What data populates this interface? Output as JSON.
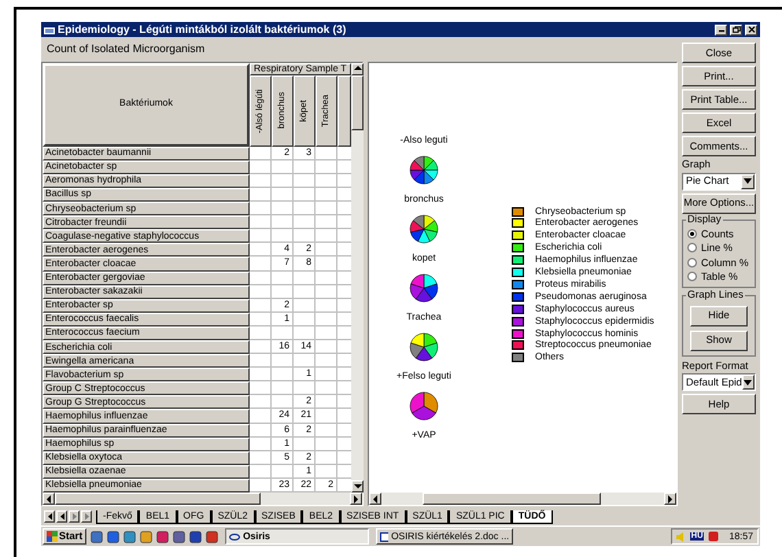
{
  "window": {
    "title": "Epidemiology - Légúti mintákból izolált baktériumok (3)"
  },
  "caption": "Count of Isolated Microorganism",
  "table": {
    "group_header": "Respiratory Sample T",
    "row_header": "Baktériumok",
    "columns": [
      "-Alsó légúti",
      "bronchus",
      "köpet",
      "Trachea"
    ],
    "rows": [
      {
        "name": "Acinetobacter baumannii",
        "cells": {
          "bronchus": "2",
          "kopet": "3"
        }
      },
      {
        "name": "Acinetobacter sp",
        "cells": {}
      },
      {
        "name": "Aeromonas hydrophila",
        "cells": {}
      },
      {
        "name": "Bacillus sp",
        "cells": {}
      },
      {
        "name": "Chryseobacterium sp",
        "cells": {}
      },
      {
        "name": "Citrobacter freundii",
        "cells": {}
      },
      {
        "name": "Coagulase-negative staphylococcus",
        "cells": {}
      },
      {
        "name": "Enterobacter aerogenes",
        "cells": {
          "bronchus": "4",
          "kopet": "2"
        }
      },
      {
        "name": "Enterobacter cloacae",
        "cells": {
          "bronchus": "7",
          "kopet": "8"
        }
      },
      {
        "name": "Enterobacter gergoviae",
        "cells": {}
      },
      {
        "name": "Enterobacter sakazakii",
        "cells": {}
      },
      {
        "name": "Enterobacter sp",
        "cells": {
          "bronchus": "2"
        }
      },
      {
        "name": "Enterococcus faecalis",
        "cells": {
          "bronchus": "1"
        }
      },
      {
        "name": "Enterococcus faecium",
        "cells": {}
      },
      {
        "name": "Escherichia coli",
        "cells": {
          "bronchus": "16",
          "kopet": "14"
        }
      },
      {
        "name": "Ewingella americana",
        "cells": {}
      },
      {
        "name": "Flavobacterium sp",
        "cells": {
          "kopet": "1"
        }
      },
      {
        "name": "Group C Streptococcus",
        "cells": {}
      },
      {
        "name": "Group G Streptococcus",
        "cells": {
          "kopet": "2"
        }
      },
      {
        "name": "Haemophilus influenzae",
        "cells": {
          "bronchus": "24",
          "kopet": "21"
        }
      },
      {
        "name": "Haemophilus parainfluenzae",
        "cells": {
          "bronchus": "6",
          "kopet": "2"
        }
      },
      {
        "name": "Haemophilus sp",
        "cells": {
          "bronchus": "1"
        }
      },
      {
        "name": "Klebsiella oxytoca",
        "cells": {
          "bronchus": "5",
          "kopet": "2"
        }
      },
      {
        "name": "Klebsiella ozaenae",
        "cells": {
          "kopet": "1"
        }
      },
      {
        "name": "Klebsiella pneumoniae",
        "cells": {
          "bronchus": "23",
          "kopet": "22",
          "trachea": "2"
        }
      }
    ]
  },
  "chart": {
    "pie_labels": [
      "-Also leguti",
      "bronchus",
      "kopet",
      "Trachea",
      "+Felso leguti",
      "+VAP"
    ],
    "legend": [
      {
        "label": "Chryseobacterium sp",
        "color": "#e08c00"
      },
      {
        "label": "Enterobacter aerogenes",
        "color": "#ffff00"
      },
      {
        "label": "Enterobacter cloacae",
        "color": "#e6f500"
      },
      {
        "label": "Escherichia coli",
        "color": "#33ee11"
      },
      {
        "label": "Haemophilus influenzae",
        "color": "#11ee77"
      },
      {
        "label": "Klebsiella pneumoniae",
        "color": "#11ffee"
      },
      {
        "label": "Proteus mirabilis",
        "color": "#1188ee"
      },
      {
        "label": "Pseudomonas aeruginosa",
        "color": "#0033ee"
      },
      {
        "label": "Staphylococcus aureus",
        "color": "#6611dd"
      },
      {
        "label": "Staphylococcus epidermidis",
        "color": "#aa11dd"
      },
      {
        "label": "Staphylococcus hominis",
        "color": "#ee11cc"
      },
      {
        "label": "Streptococcus pneumoniae",
        "color": "#ee1155"
      },
      {
        "label": "Others",
        "color": "#808080"
      }
    ]
  },
  "side_panel": {
    "buttons_top": [
      "Close",
      "Print...",
      "Print Table...",
      "Excel",
      "Comments..."
    ],
    "graph_label": "Graph",
    "graph_select": "Pie Chart",
    "more_options": "More Options...",
    "display": {
      "title": "Display",
      "options": [
        {
          "label": "Counts",
          "selected": true
        },
        {
          "label": "Line %",
          "selected": false
        },
        {
          "label": "Column %",
          "selected": false
        },
        {
          "label": "Table %",
          "selected": false
        }
      ]
    },
    "graph_lines": {
      "title": "Graph Lines",
      "buttons": [
        "Hide",
        "Show"
      ]
    },
    "report_label": "Report Format",
    "report_select": "Default Epid",
    "help": "Help"
  },
  "sheet_tabs": [
    {
      "label": "-Fekvő",
      "selected": false
    },
    {
      "label": "BEL1",
      "selected": false
    },
    {
      "label": "OFG",
      "selected": false
    },
    {
      "label": "SZÜL2",
      "selected": false
    },
    {
      "label": "SZISEB",
      "selected": false
    },
    {
      "label": "BEL2",
      "selected": false
    },
    {
      "label": "SZISEB INT",
      "selected": false
    },
    {
      "label": "SZÜL1",
      "selected": false
    },
    {
      "label": "SZÜL1 PIC",
      "selected": false
    },
    {
      "label": "TÜDŐ",
      "selected": true
    }
  ],
  "taskbar": {
    "start": "Start",
    "tasks": [
      "Osiris",
      "OSIRIS kiértékelés 2.doc ..."
    ],
    "tray_lang": "HU",
    "clock": "18:57"
  }
}
